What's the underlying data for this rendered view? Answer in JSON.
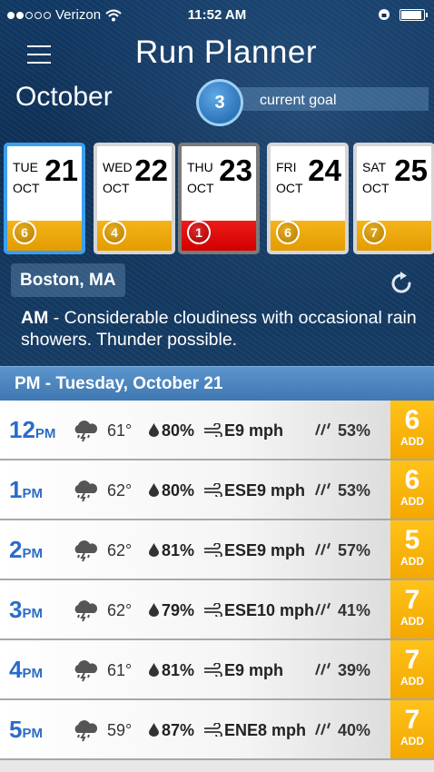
{
  "status_bar": {
    "carrier": "Verizon",
    "time": "11:52 AM"
  },
  "header": {
    "title": "Run Planner",
    "month": "October",
    "goal_value": "3",
    "goal_label": "current goal"
  },
  "days": [
    {
      "dow": "TUE",
      "mon": "OCT",
      "num": "21",
      "score": "6",
      "state": "selected"
    },
    {
      "dow": "WED",
      "mon": "OCT",
      "num": "22",
      "score": "4",
      "state": "normal"
    },
    {
      "dow": "THU",
      "mon": "OCT",
      "num": "23",
      "score": "1",
      "state": "today"
    },
    {
      "dow": "FRI",
      "mon": "OCT",
      "num": "24",
      "score": "6",
      "state": "normal"
    },
    {
      "dow": "SAT",
      "mon": "OCT",
      "num": "25",
      "score": "7",
      "state": "normal"
    }
  ],
  "location": "Boston, MA",
  "forecast": {
    "period": "AM",
    "separator": " - ",
    "text": "Considerable cloudiness with occasional rain showers. Thunder possible."
  },
  "section_header": "PM - Tuesday, October 21",
  "hours": [
    {
      "hour": "12",
      "ampm": "PM",
      "temp": "61°",
      "humidity": "80%",
      "wind": "E9 mph",
      "precip": "53%",
      "score": "6",
      "add": "ADD"
    },
    {
      "hour": "1",
      "ampm": "PM",
      "temp": "62°",
      "humidity": "80%",
      "wind": "ESE9 mph",
      "precip": "53%",
      "score": "6",
      "add": "ADD"
    },
    {
      "hour": "2",
      "ampm": "PM",
      "temp": "62°",
      "humidity": "81%",
      "wind": "ESE9 mph",
      "precip": "57%",
      "score": "5",
      "add": "ADD"
    },
    {
      "hour": "3",
      "ampm": "PM",
      "temp": "62°",
      "humidity": "79%",
      "wind": "ESE10 mph",
      "precip": "41%",
      "score": "7",
      "add": "ADD"
    },
    {
      "hour": "4",
      "ampm": "PM",
      "temp": "61°",
      "humidity": "81%",
      "wind": "E9 mph",
      "precip": "39%",
      "score": "7",
      "add": "ADD"
    },
    {
      "hour": "5",
      "ampm": "PM",
      "temp": "59°",
      "humidity": "87%",
      "wind": "ENE8 mph",
      "precip": "40%",
      "score": "7",
      "add": "ADD"
    }
  ],
  "icons": {
    "menu": "hamburger-icon",
    "refresh": "refresh-icon",
    "weather": "thunderstorm-cloud-icon",
    "humidity": "water-drop-icon",
    "wind": "wind-icon",
    "precip": "rain-icon"
  },
  "colors": {
    "accent_blue": "#3aa0ef",
    "score_yellow": "#f5b41a",
    "score_red": "#d10000",
    "time_blue": "#2a6cc9"
  }
}
